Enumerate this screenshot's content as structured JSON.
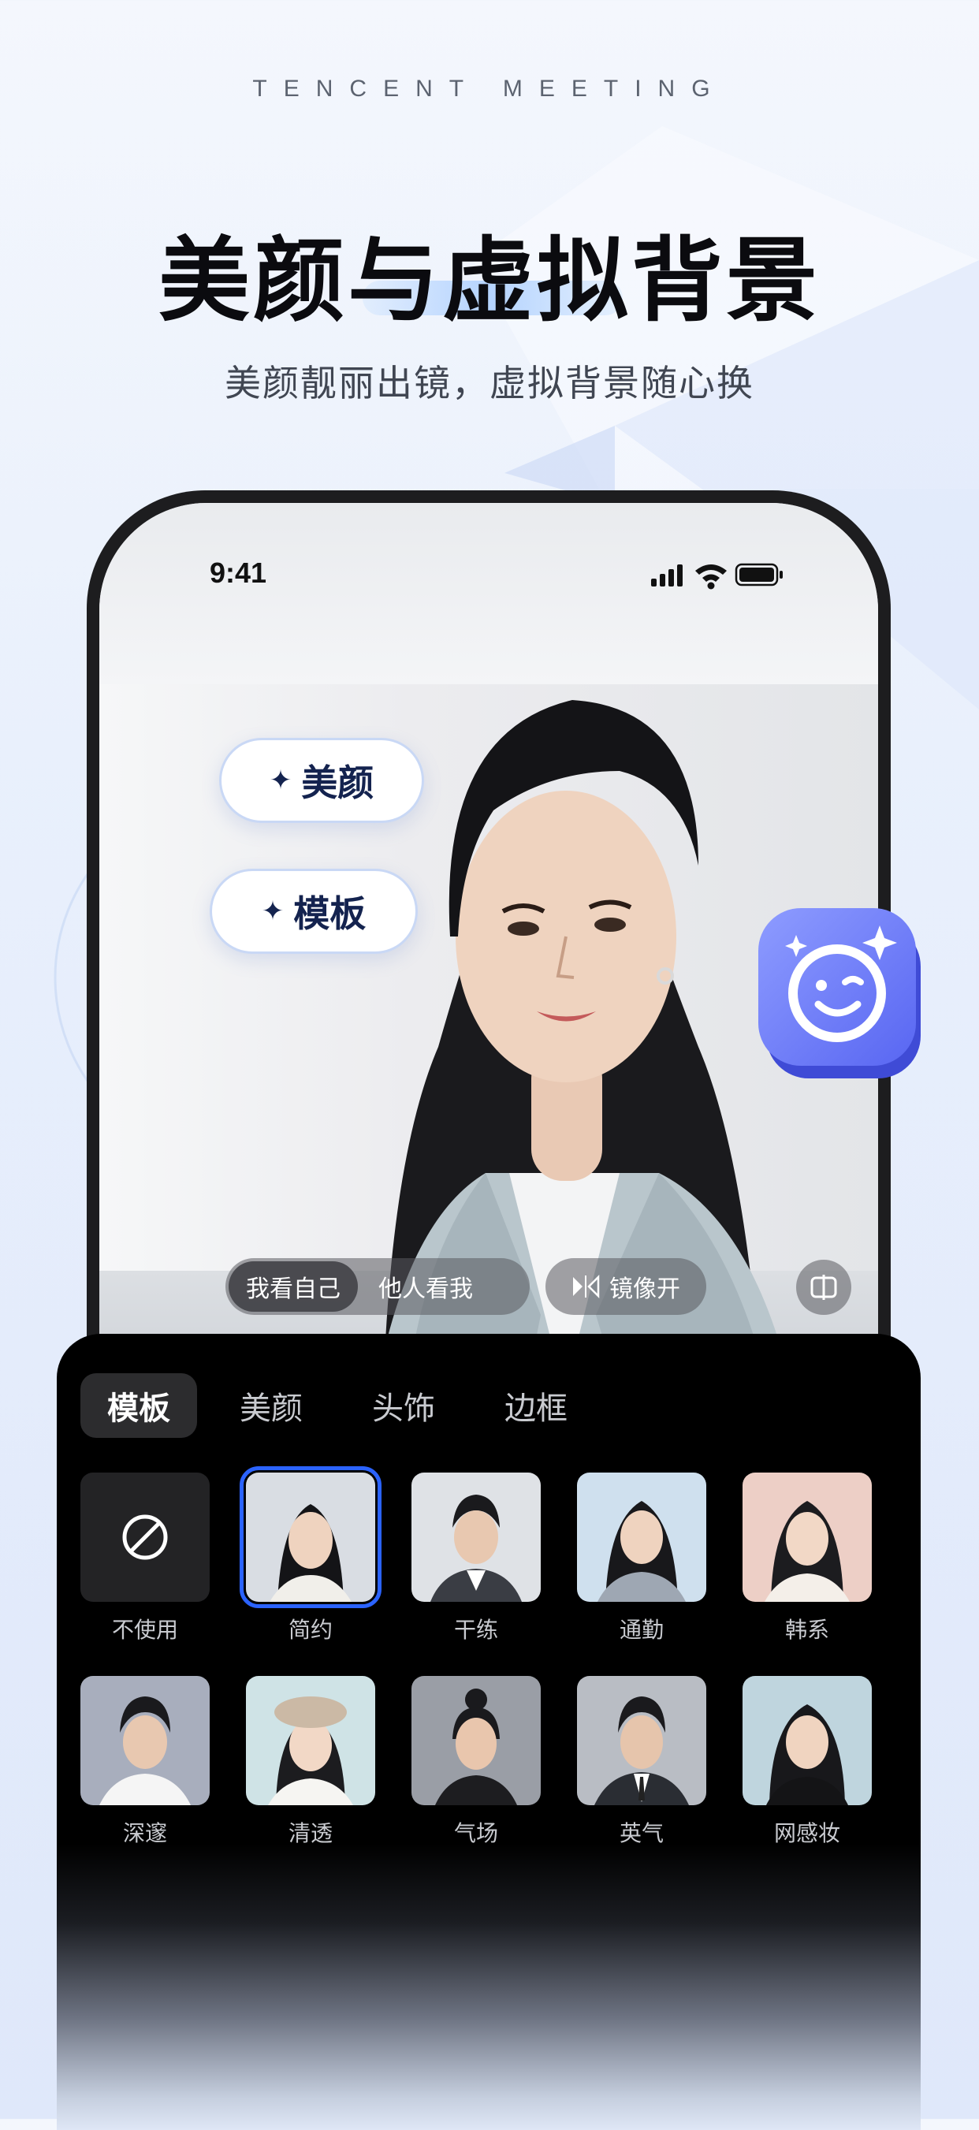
{
  "brand": "TENCENT MEETING",
  "headline": "美颜与虚拟背景",
  "subtitle": "美颜靓丽出镜，虚拟背景随心换",
  "status_bar": {
    "time": "9:41",
    "icons": [
      "signal-icon",
      "wifi-icon",
      "battery-icon"
    ]
  },
  "side_pills": [
    {
      "label": "美颜",
      "icon": "sparkle-icon"
    },
    {
      "label": "模板",
      "icon": "sparkle-icon"
    }
  ],
  "camera_controls": {
    "view_toggle": {
      "options": [
        "我看自己",
        "他人看我"
      ],
      "selected": "我看自己"
    },
    "mirror": {
      "label": "镜像开",
      "icon": "mirror-icon"
    },
    "split_icon": "split-view-icon"
  },
  "feature_badge_icon": "smiley-sparkle-icon",
  "panel": {
    "tabs": [
      "模板",
      "美颜",
      "头饰",
      "边框"
    ],
    "active_tab": "模板",
    "templates": [
      {
        "label": "不使用",
        "icon": "none-icon"
      },
      {
        "label": "简约",
        "selected": true
      },
      {
        "label": "干练"
      },
      {
        "label": "通勤"
      },
      {
        "label": "韩系"
      },
      {
        "label": "深邃"
      },
      {
        "label": "清透"
      },
      {
        "label": "气场"
      },
      {
        "label": "英气"
      },
      {
        "label": "网感妆"
      }
    ]
  },
  "colors": {
    "accent": "#2b63ff",
    "title_text": "#0b0b0f",
    "pill_text": "#14234f",
    "panel_bg": "#000000",
    "badge": "#6f7cff"
  }
}
